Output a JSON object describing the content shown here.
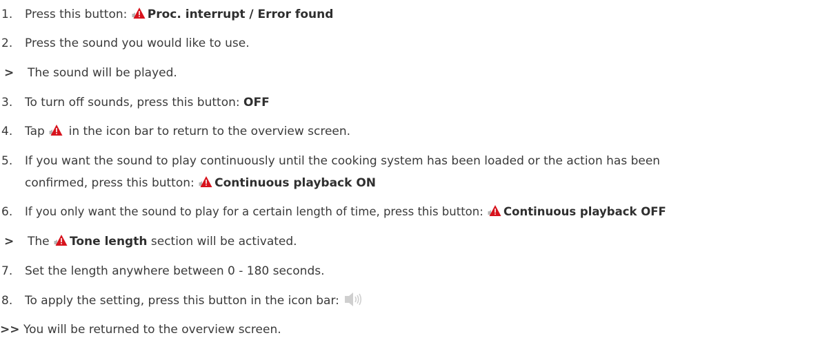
{
  "steps": [
    {
      "marker": "1.",
      "pre": "Press this button: ",
      "bold": "Proc. interrupt / Error found",
      "icon": "sound-alarm-icon"
    },
    {
      "marker": "2.",
      "text": "Press the sound you would like to use."
    },
    {
      "marker": ">",
      "text": "The sound will be played."
    },
    {
      "marker": "3.",
      "pre": "To turn off sounds, press this button: ",
      "bold": "OFF"
    },
    {
      "marker": "4.",
      "pre": "Tap ",
      "post": " in the icon bar to return to the overview screen.",
      "icon": "sound-alarm-icon"
    },
    {
      "marker": "5.",
      "line1": "If you want the sound to play continuously until the cooking system has been loaded or the action has been",
      "pre": "confirmed, press this button: ",
      "bold": "Continuous playback ON",
      "icon": "sound-alarm-icon"
    },
    {
      "marker": "6.",
      "pre": "If you only want the sound to play for a certain length of time, press this button: ",
      "bold": "Continuous playback OFF",
      "icon": "sound-alarm-icon"
    },
    {
      "marker": ">",
      "pre": "The ",
      "bold": "Tone length",
      "post": " section will be activated.",
      "icon": "sound-alarm-icon"
    },
    {
      "marker": "7.",
      "text": "Set the length anywhere between 0 - 180 seconds."
    },
    {
      "marker": "8.",
      "pre": "To apply the setting, press this button in the icon bar: ",
      "icon": "speaker-volume-icon"
    },
    {
      "marker": ">>",
      "text": "You will be returned to the overview screen."
    }
  ],
  "colors": {
    "text": "#3a3a3a",
    "alarm_red": "#d7131d",
    "icon_gray": "#b5b5b5"
  }
}
